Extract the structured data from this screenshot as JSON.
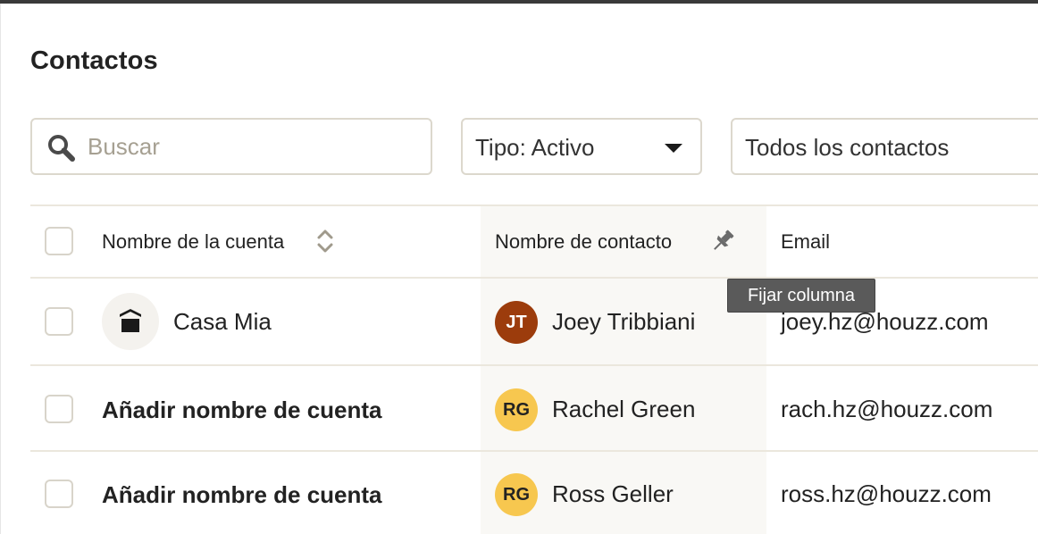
{
  "page": {
    "title": "Contactos"
  },
  "search": {
    "placeholder": "Buscar",
    "value": ""
  },
  "filters": {
    "type": {
      "label": "Tipo: Activo"
    },
    "contacts": {
      "label": "Todos los contactos"
    }
  },
  "table": {
    "headers": {
      "account": "Nombre de la cuenta",
      "contact": "Nombre de contacto",
      "email": "Email"
    },
    "rows": [
      {
        "account": "Casa Mia",
        "account_bold": false,
        "initials": "JT",
        "contact": "Joey Tribbiani",
        "email": "joey.hz@houzz.com",
        "avatar_bg": "#9c3c0c",
        "avatar_fg": "#ffffff"
      },
      {
        "account": "Añadir nombre de cuenta",
        "account_bold": true,
        "initials": "RG",
        "contact": "Rachel Green",
        "email": "rach.hz@houzz.com",
        "avatar_bg": "#f7c74f",
        "avatar_fg": "#222222"
      },
      {
        "account": "Añadir nombre de cuenta",
        "account_bold": true,
        "initials": "RG",
        "contact": "Ross Geller",
        "email": "ross.hz@houzz.com",
        "avatar_bg": "#f7c74f",
        "avatar_fg": "#222222"
      }
    ]
  },
  "tooltip": {
    "text": "Fijar columna"
  },
  "icons": {
    "search": "search-icon",
    "caret": "caret-down-icon",
    "sort": "sort-icon",
    "pin": "pin-icon",
    "house": "house-icon"
  },
  "colors": {
    "border": "#dcd8cd",
    "placeholder": "#a6a092",
    "pinned_column_bg": "#f9f8f5",
    "tooltip_bg": "#5a5a5a"
  }
}
